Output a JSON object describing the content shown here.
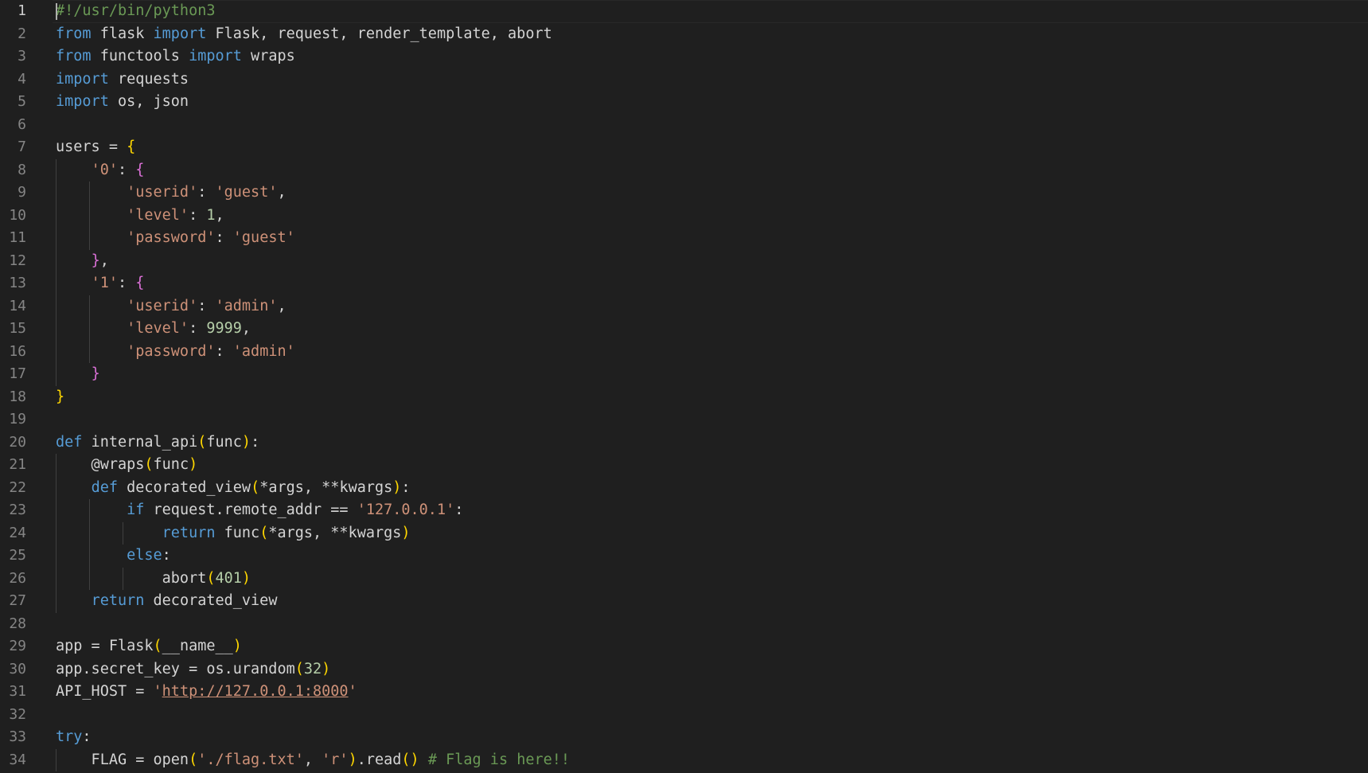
{
  "editor": {
    "language": "python",
    "cursor_line": 1,
    "colors": {
      "background": "#1f1f1f",
      "keyword": "#569cd6",
      "string": "#ce9178",
      "number": "#b5cea8",
      "comment": "#6a9955",
      "bracket_level1": "#ffd700",
      "bracket_level2": "#da70d6",
      "text": "#d4d4d4",
      "line_number": "#858585"
    },
    "lines": [
      {
        "n": "1",
        "indent": 0,
        "tokens": [
          [
            "com",
            "#!/usr/bin/python3"
          ]
        ]
      },
      {
        "n": "2",
        "indent": 0,
        "tokens": [
          [
            "kw",
            "from"
          ],
          [
            "plain",
            " flask "
          ],
          [
            "kw",
            "import"
          ],
          [
            "plain",
            " Flask, request, render_template, abort"
          ]
        ]
      },
      {
        "n": "3",
        "indent": 0,
        "tokens": [
          [
            "kw",
            "from"
          ],
          [
            "plain",
            " functools "
          ],
          [
            "kw",
            "import"
          ],
          [
            "plain",
            " wraps"
          ]
        ]
      },
      {
        "n": "4",
        "indent": 0,
        "tokens": [
          [
            "kw",
            "import"
          ],
          [
            "plain",
            " requests"
          ]
        ]
      },
      {
        "n": "5",
        "indent": 0,
        "tokens": [
          [
            "kw",
            "import"
          ],
          [
            "plain",
            " os, json"
          ]
        ]
      },
      {
        "n": "6",
        "indent": 0,
        "tokens": []
      },
      {
        "n": "7",
        "indent": 0,
        "tokens": [
          [
            "plain",
            "users = "
          ],
          [
            "b1",
            "{"
          ]
        ]
      },
      {
        "n": "8",
        "indent": 1,
        "tokens": [
          [
            "plain",
            "    "
          ],
          [
            "str",
            "'0'"
          ],
          [
            "plain",
            ": "
          ],
          [
            "b2",
            "{"
          ]
        ]
      },
      {
        "n": "9",
        "indent": 2,
        "tokens": [
          [
            "plain",
            "        "
          ],
          [
            "str",
            "'userid'"
          ],
          [
            "plain",
            ": "
          ],
          [
            "str",
            "'guest'"
          ],
          [
            "plain",
            ","
          ]
        ]
      },
      {
        "n": "10",
        "indent": 2,
        "tokens": [
          [
            "plain",
            "        "
          ],
          [
            "str",
            "'level'"
          ],
          [
            "plain",
            ": "
          ],
          [
            "num",
            "1"
          ],
          [
            "plain",
            ","
          ]
        ]
      },
      {
        "n": "11",
        "indent": 2,
        "tokens": [
          [
            "plain",
            "        "
          ],
          [
            "str",
            "'password'"
          ],
          [
            "plain",
            ": "
          ],
          [
            "str",
            "'guest'"
          ]
        ]
      },
      {
        "n": "12",
        "indent": 1,
        "tokens": [
          [
            "plain",
            "    "
          ],
          [
            "b2",
            "}"
          ],
          [
            "plain",
            ","
          ]
        ]
      },
      {
        "n": "13",
        "indent": 1,
        "tokens": [
          [
            "plain",
            "    "
          ],
          [
            "str",
            "'1'"
          ],
          [
            "plain",
            ": "
          ],
          [
            "b2",
            "{"
          ]
        ]
      },
      {
        "n": "14",
        "indent": 2,
        "tokens": [
          [
            "plain",
            "        "
          ],
          [
            "str",
            "'userid'"
          ],
          [
            "plain",
            ": "
          ],
          [
            "str",
            "'admin'"
          ],
          [
            "plain",
            ","
          ]
        ]
      },
      {
        "n": "15",
        "indent": 2,
        "tokens": [
          [
            "plain",
            "        "
          ],
          [
            "str",
            "'level'"
          ],
          [
            "plain",
            ": "
          ],
          [
            "num",
            "9999"
          ],
          [
            "plain",
            ","
          ]
        ]
      },
      {
        "n": "16",
        "indent": 2,
        "tokens": [
          [
            "plain",
            "        "
          ],
          [
            "str",
            "'password'"
          ],
          [
            "plain",
            ": "
          ],
          [
            "str",
            "'admin'"
          ]
        ]
      },
      {
        "n": "17",
        "indent": 1,
        "tokens": [
          [
            "plain",
            "    "
          ],
          [
            "b2",
            "}"
          ]
        ]
      },
      {
        "n": "18",
        "indent": 0,
        "tokens": [
          [
            "b1",
            "}"
          ]
        ]
      },
      {
        "n": "19",
        "indent": 0,
        "tokens": []
      },
      {
        "n": "20",
        "indent": 0,
        "tokens": [
          [
            "kw",
            "def"
          ],
          [
            "plain",
            " internal_api"
          ],
          [
            "b1",
            "("
          ],
          [
            "plain",
            "func"
          ],
          [
            "b1",
            ")"
          ],
          [
            "plain",
            ":"
          ]
        ]
      },
      {
        "n": "21",
        "indent": 1,
        "tokens": [
          [
            "plain",
            "    @wraps"
          ],
          [
            "b1",
            "("
          ],
          [
            "plain",
            "func"
          ],
          [
            "b1",
            ")"
          ]
        ]
      },
      {
        "n": "22",
        "indent": 1,
        "tokens": [
          [
            "plain",
            "    "
          ],
          [
            "kw",
            "def"
          ],
          [
            "plain",
            " decorated_view"
          ],
          [
            "b1",
            "("
          ],
          [
            "plain",
            "*args, **kwargs"
          ],
          [
            "b1",
            ")"
          ],
          [
            "plain",
            ":"
          ]
        ]
      },
      {
        "n": "23",
        "indent": 2,
        "tokens": [
          [
            "plain",
            "        "
          ],
          [
            "kw",
            "if"
          ],
          [
            "plain",
            " request.remote_addr == "
          ],
          [
            "str",
            "'127.0.0.1'"
          ],
          [
            "plain",
            ":"
          ]
        ]
      },
      {
        "n": "24",
        "indent": 3,
        "tokens": [
          [
            "plain",
            "            "
          ],
          [
            "kw",
            "return"
          ],
          [
            "plain",
            " func"
          ],
          [
            "b1",
            "("
          ],
          [
            "plain",
            "*args, **kwargs"
          ],
          [
            "b1",
            ")"
          ]
        ]
      },
      {
        "n": "25",
        "indent": 2,
        "tokens": [
          [
            "plain",
            "        "
          ],
          [
            "kw",
            "else"
          ],
          [
            "plain",
            ":"
          ]
        ]
      },
      {
        "n": "26",
        "indent": 3,
        "tokens": [
          [
            "plain",
            "            abort"
          ],
          [
            "b1",
            "("
          ],
          [
            "num",
            "401"
          ],
          [
            "b1",
            ")"
          ]
        ]
      },
      {
        "n": "27",
        "indent": 1,
        "tokens": [
          [
            "plain",
            "    "
          ],
          [
            "kw",
            "return"
          ],
          [
            "plain",
            " decorated_view"
          ]
        ]
      },
      {
        "n": "28",
        "indent": 0,
        "tokens": []
      },
      {
        "n": "29",
        "indent": 0,
        "tokens": [
          [
            "plain",
            "app = Flask"
          ],
          [
            "b1",
            "("
          ],
          [
            "plain",
            "__name__"
          ],
          [
            "b1",
            ")"
          ]
        ]
      },
      {
        "n": "30",
        "indent": 0,
        "tokens": [
          [
            "plain",
            "app.secret_key = os.urandom"
          ],
          [
            "b1",
            "("
          ],
          [
            "num",
            "32"
          ],
          [
            "b1",
            ")"
          ]
        ]
      },
      {
        "n": "31",
        "indent": 0,
        "tokens": [
          [
            "plain",
            "API_HOST = "
          ],
          [
            "str",
            "'"
          ],
          [
            "url",
            "http://127.0.0.1:8000"
          ],
          [
            "str",
            "'"
          ]
        ]
      },
      {
        "n": "32",
        "indent": 0,
        "tokens": []
      },
      {
        "n": "33",
        "indent": 0,
        "tokens": [
          [
            "kw",
            "try"
          ],
          [
            "plain",
            ":"
          ]
        ]
      },
      {
        "n": "34",
        "indent": 1,
        "tokens": [
          [
            "plain",
            "    FLAG = open"
          ],
          [
            "b1",
            "("
          ],
          [
            "str",
            "'./flag.txt'"
          ],
          [
            "plain",
            ", "
          ],
          [
            "str",
            "'r'"
          ],
          [
            "b1",
            ")"
          ],
          [
            "plain",
            ".read"
          ],
          [
            "b1",
            "()"
          ],
          [
            "plain",
            " "
          ],
          [
            "com",
            "# Flag is here!!"
          ]
        ]
      }
    ]
  }
}
